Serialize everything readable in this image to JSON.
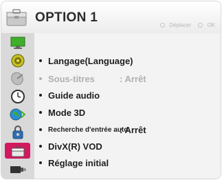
{
  "header": {
    "title": "OPTION 1",
    "hint_move": "Déplacer",
    "hint_ok": "OK"
  },
  "sidebar": {
    "items": [
      {
        "icon": "picture-monitor-icon"
      },
      {
        "icon": "audio-speaker-icon"
      },
      {
        "icon": "satellite-dish-icon"
      },
      {
        "icon": "clock-icon"
      },
      {
        "icon": "network-globe-icon"
      },
      {
        "icon": "lock-icon"
      },
      {
        "icon": "option-briefcase-icon",
        "active": true
      },
      {
        "icon": "input-projector-icon"
      }
    ]
  },
  "menu": {
    "items": [
      {
        "label": "Langage(Language)",
        "value": ""
      },
      {
        "label": "Sous-titres",
        "value": ": Arrêt",
        "disabled": true
      },
      {
        "label": "Guide audio",
        "value": ""
      },
      {
        "label": "Mode 3D",
        "value": ""
      },
      {
        "label": "Recherche d'entrée auto",
        "value": ": Arrêt"
      },
      {
        "label": "DivX(R) VOD",
        "value": ""
      },
      {
        "label": "Réglage initial",
        "value": ""
      }
    ]
  },
  "colors": {
    "accent": "#d2195f",
    "sidebar_bg": "#d9d9d9",
    "disabled_text": "#b0b0b0"
  }
}
